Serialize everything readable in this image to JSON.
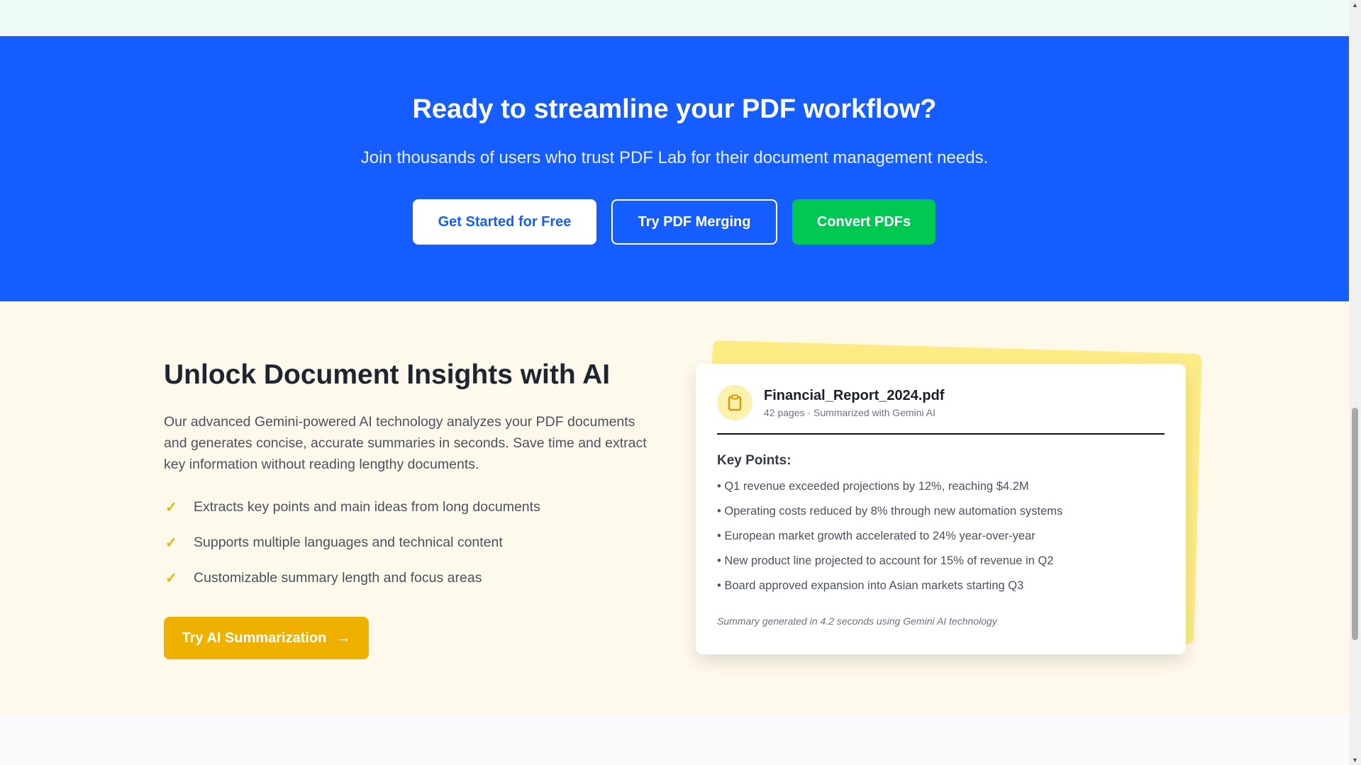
{
  "cta": {
    "title": "Ready to streamline your PDF workflow?",
    "subtitle": "Join thousands of users who trust PDF Lab for their document management needs.",
    "buttons": [
      "Get Started for Free",
      "Try PDF Merging",
      "Convert PDFs"
    ]
  },
  "ai": {
    "title": "Unlock Document Insights with AI",
    "description": "Our advanced Gemini-powered AI technology analyzes your PDF documents and generates concise, accurate summaries in seconds. Save time and extract key information without reading lengthy documents.",
    "features": [
      "Extracts key points and main ideas from long documents",
      "Supports multiple languages and technical content",
      "Customizable summary length and focus areas"
    ],
    "button": "Try AI Summarization",
    "card": {
      "filename": "Financial_Report_2024.pdf",
      "meta": "42 pages · Summarized with Gemini AI",
      "heading": "Key Points:",
      "points": [
        "• Q1 revenue exceeded projections by 12%, reaching $4.2M",
        "• Operating costs reduced by 8% through new automation systems",
        "• European market growth accelerated to 24% year-over-year",
        "• New product line projected to account for 15% of revenue in Q2",
        "• Board approved expansion into Asian markets starting Q3"
      ],
      "footer": "Summary generated in 4.2 seconds using Gemini AI technology"
    }
  }
}
